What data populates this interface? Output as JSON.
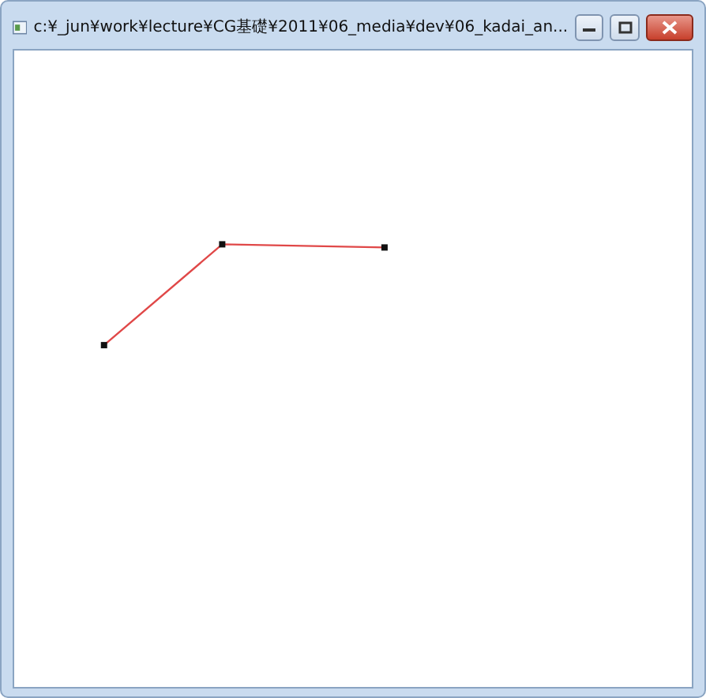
{
  "window": {
    "title": "c:¥_jun¥work¥lecture¥CG基礎¥2011¥06_media¥dev¥06_kadai_an..."
  }
}
